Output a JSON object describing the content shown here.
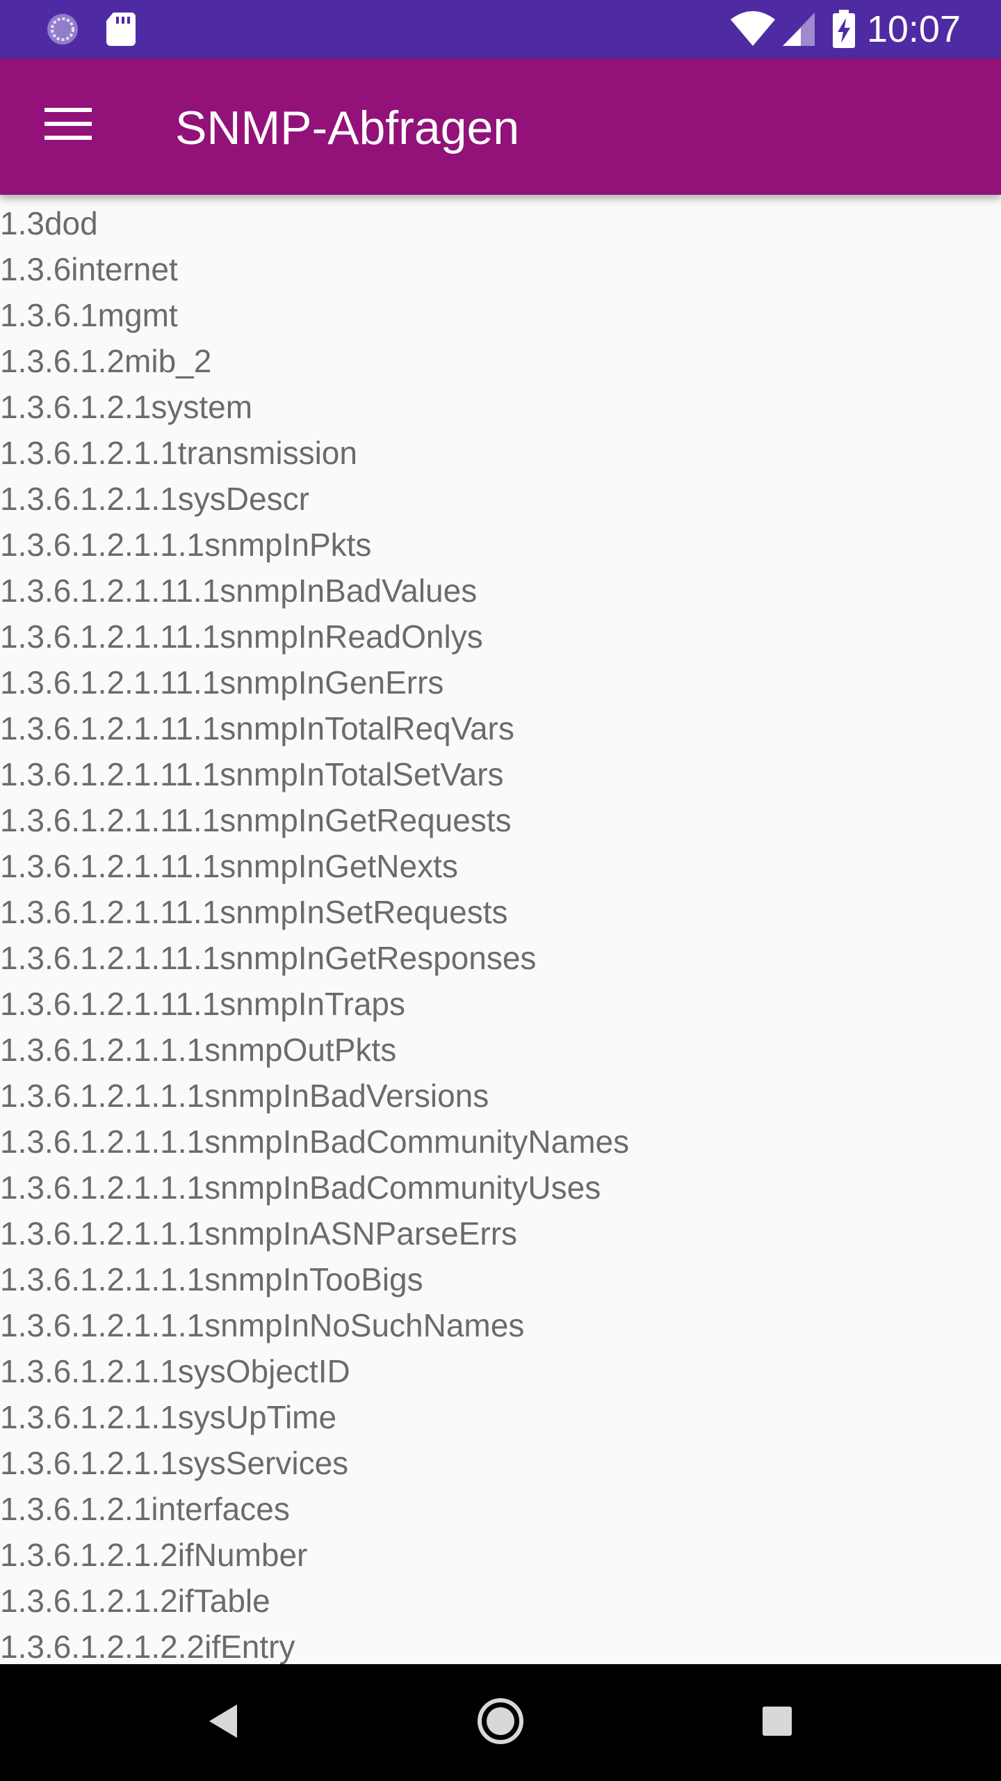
{
  "status_bar": {
    "time": "10:07",
    "left_icons": [
      "sync-icon",
      "sd-card-icon"
    ],
    "right_icons": [
      "wifi-icon",
      "signal-icon",
      "battery-charging-icon"
    ],
    "color": "#4f2ba3"
  },
  "app_bar": {
    "title": "SNMP-Abfragen",
    "menu_icon": "hamburger-menu-icon",
    "color": "#921279"
  },
  "oid_list": [
    "1.3dod",
    "1.3.6internet",
    "1.3.6.1mgmt",
    "1.3.6.1.2mib_2",
    "1.3.6.1.2.1system",
    "1.3.6.1.2.1.1transmission",
    "1.3.6.1.2.1.1sysDescr",
    "1.3.6.1.2.1.1.1snmpInPkts",
    "1.3.6.1.2.1.11.1snmpInBadValues",
    "1.3.6.1.2.1.11.1snmpInReadOnlys",
    "1.3.6.1.2.1.11.1snmpInGenErrs",
    "1.3.6.1.2.1.11.1snmpInTotalReqVars",
    "1.3.6.1.2.1.11.1snmpInTotalSetVars",
    "1.3.6.1.2.1.11.1snmpInGetRequests",
    "1.3.6.1.2.1.11.1snmpInGetNexts",
    "1.3.6.1.2.1.11.1snmpInSetRequests",
    "1.3.6.1.2.1.11.1snmpInGetResponses",
    "1.3.6.1.2.1.11.1snmpInTraps",
    "1.3.6.1.2.1.1.1snmpOutPkts",
    "1.3.6.1.2.1.1.1snmpInBadVersions",
    "1.3.6.1.2.1.1.1snmpInBadCommunityNames",
    "1.3.6.1.2.1.1.1snmpInBadCommunityUses",
    "1.3.6.1.2.1.1.1snmpInASNParseErrs",
    "1.3.6.1.2.1.1.1snmpInTooBigs",
    "1.3.6.1.2.1.1.1snmpInNoSuchNames",
    "1.3.6.1.2.1.1sysObjectID",
    "1.3.6.1.2.1.1sysUpTime",
    "1.3.6.1.2.1.1sysServices",
    "1.3.6.1.2.1interfaces",
    "1.3.6.1.2.1.2ifNumber",
    "1.3.6.1.2.1.2ifTable",
    "1.3.6.1.2.1.2.2ifEntry"
  ],
  "nav_bar": {
    "buttons": [
      "back-icon",
      "home-icon",
      "recents-icon"
    ]
  }
}
